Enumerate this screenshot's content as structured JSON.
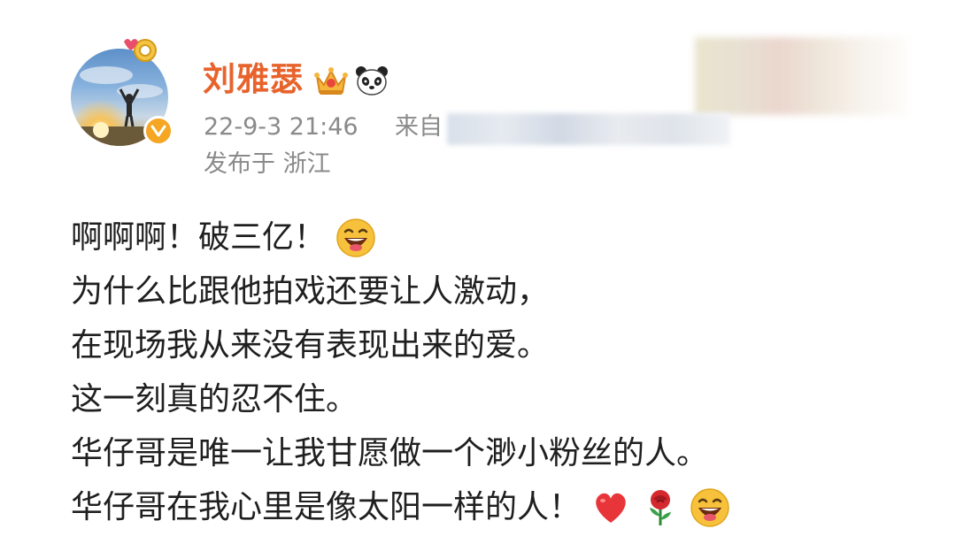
{
  "post": {
    "author": {
      "name": "刘雅瑟",
      "avatar_icon": "avatar-sunset-person",
      "verified_icon": "verified-badge-icon",
      "badges": [
        "crown-icon",
        "panda-icon"
      ]
    },
    "meta": {
      "time": "22-9-3 21:46",
      "source_label": "来自",
      "location": "发布于 浙江"
    },
    "lines": [
      "啊啊啊！破三亿！",
      "为什么比跟他拍戏还要让人激动，",
      "在现场我从来没有表现出来的爱。",
      "这一刻真的忍不住。",
      "华仔哥是唯一让我甘愿做一个渺小粉丝的人。",
      "华仔哥在我心里是像太阳一样的人！"
    ],
    "emojis": {
      "line1": [
        "laughing-emoji"
      ],
      "line6": [
        "heart-emoji",
        "rose-emoji",
        "laughing-emoji"
      ]
    }
  },
  "colors": {
    "username": "#e8632c",
    "meta": "#8a8a8a",
    "body": "#1f1f1f",
    "verified": "#f5a623"
  }
}
